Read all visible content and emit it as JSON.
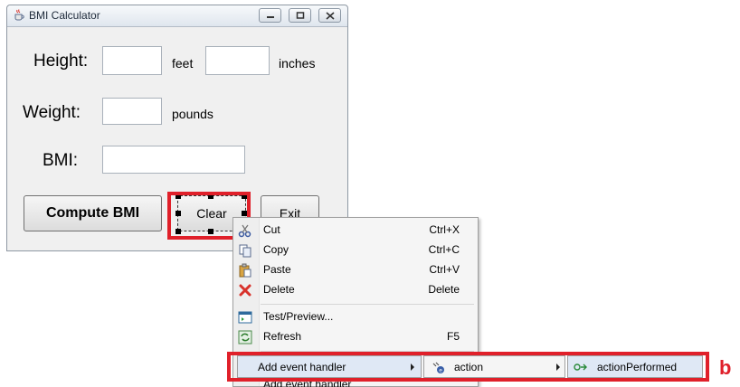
{
  "window": {
    "title": "BMI Calculator"
  },
  "form": {
    "height_label": "Height:",
    "feet_label": "feet",
    "inches_label": "inches",
    "weight_label": "Weight:",
    "pounds_label": "pounds",
    "bmi_label": "BMI:",
    "feet_value": "",
    "inches_value": "",
    "weight_value": "",
    "bmi_value": ""
  },
  "buttons": {
    "compute": "Compute BMI",
    "clear": "Clear",
    "exit": "Exit"
  },
  "context_menu": {
    "items": [
      {
        "label": "Cut",
        "shortcut": "Ctrl+X",
        "icon": "cut-icon"
      },
      {
        "label": "Copy",
        "shortcut": "Ctrl+C",
        "icon": "copy-icon"
      },
      {
        "label": "Paste",
        "shortcut": "Ctrl+V",
        "icon": "paste-icon"
      },
      {
        "label": "Delete",
        "shortcut": "Delete",
        "icon": "delete-icon"
      },
      {
        "label": "Test/Preview...",
        "shortcut": "",
        "icon": "preview-icon"
      },
      {
        "label": "Refresh",
        "shortcut": "F5",
        "icon": "refresh-icon"
      },
      {
        "label": "Add event handler",
        "shortcut": "",
        "icon": ""
      }
    ],
    "partial_item": "Add event handler"
  },
  "submenu": {
    "level1": "action",
    "level2": "actionPerformed"
  },
  "annotation": {
    "label": "b",
    "color": "#e0202a"
  }
}
